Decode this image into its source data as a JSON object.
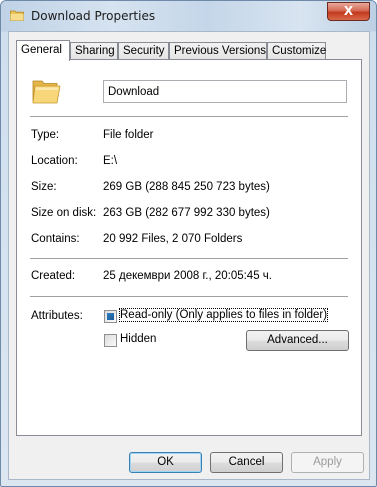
{
  "window": {
    "title": "Download Properties",
    "close_label": "X"
  },
  "tabs": [
    {
      "label": "General",
      "active": true
    },
    {
      "label": "Sharing",
      "active": false
    },
    {
      "label": "Security",
      "active": false
    },
    {
      "label": "Previous Versions",
      "active": false
    },
    {
      "label": "Customize",
      "active": false
    }
  ],
  "general": {
    "name_value": "Download",
    "props": [
      {
        "label": "Type:",
        "value": "File folder"
      },
      {
        "label": "Location:",
        "value": "E:\\"
      },
      {
        "label": "Size:",
        "value": "269 GB (288 845 250 723 bytes)"
      },
      {
        "label": "Size on disk:",
        "value": "263 GB (282 677 992 330 bytes)"
      },
      {
        "label": "Contains:",
        "value": "20 992 Files, 2 070 Folders"
      }
    ],
    "created_label": "Created:",
    "created_value": "25 декември 2008 г., 20:05:45 ч.",
    "attributes_label": "Attributes:",
    "readonly_label": "Read-only (Only applies to files in folder)",
    "readonly_state": "indeterminate",
    "hidden_label": "Hidden",
    "hidden_checked": false,
    "advanced_label": "Advanced..."
  },
  "buttons": {
    "ok": "OK",
    "cancel": "Cancel",
    "apply": "Apply"
  }
}
